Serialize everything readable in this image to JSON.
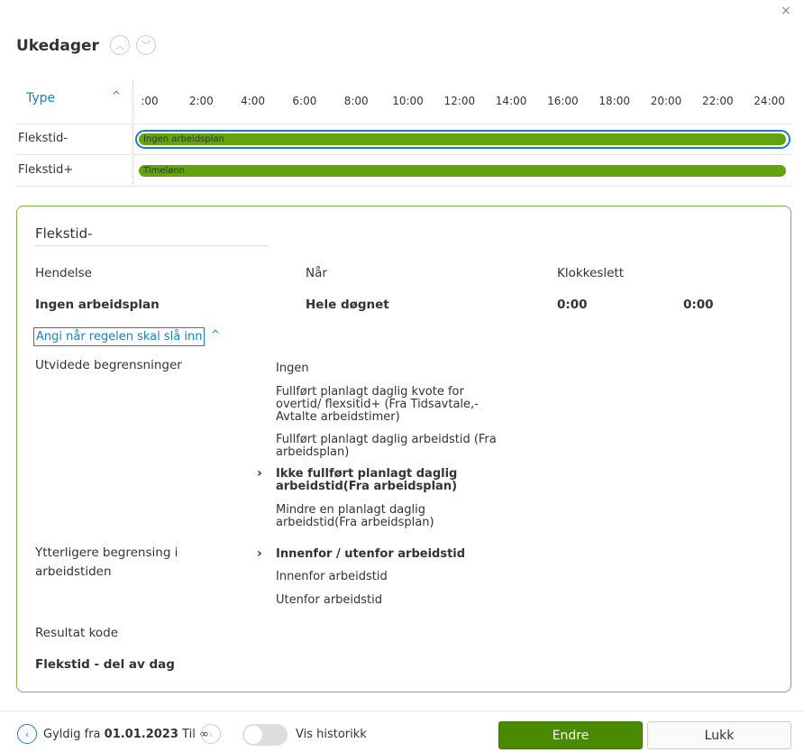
{
  "header": {
    "title": "Ukedager",
    "close": "×",
    "up": "︿",
    "down": "﹀"
  },
  "timeline": {
    "type_header": "Type",
    "sort_icon": "^",
    "hours": [
      ":00",
      "2:00",
      "4:00",
      "6:00",
      "8:00",
      "10:00",
      "12:00",
      "14:00",
      "16:00",
      "18:00",
      "20:00",
      "22:00",
      "24:00"
    ],
    "rows": [
      {
        "label": "Flekstid-",
        "bar": "Ingen arbeidsplan"
      },
      {
        "label": "Flekstid+",
        "bar": "Timelønn"
      }
    ]
  },
  "detail": {
    "name": "Flekstid-",
    "col_event": "Hendelse",
    "col_when": "Når",
    "col_time": "Klokkeslett",
    "event": "Ingen arbeidsplan",
    "when": "Hele døgnet",
    "time_from": "0:00",
    "time_to": "0:00",
    "rule_link": "Angi når regelen skal slå inn",
    "ext_label": "Utvidede begrensninger",
    "ext_options": [
      "Ingen",
      "Fullført planlagt daglig kvote for overtid/ flexsitid+ (Fra Tidsavtale,- Avtalte arbeidstimer)",
      "Fullført planlagt daglig arbeidstid (Fra arbeidsplan)",
      "Ikke fullført planlagt daglig arbeidstid(Fra arbeidsplan)",
      "Mindre en planlagt daglig arbeidstid(Fra arbeidsplan)"
    ],
    "further_label": "Ytterligere begrensing i arbeidstiden",
    "further_options": [
      "Innenfor / utenfor arbeidstid",
      "Innenfor arbeidstid",
      "Utenfor arbeidstid"
    ],
    "result_label": "Resultat kode",
    "result": "Flekstid - del av dag"
  },
  "footer": {
    "valid_from": "Gyldig fra",
    "date": "01.01.2023",
    "til": "Til ∞",
    "history": "Vis historikk",
    "edit": "Endre",
    "close": "Lukk"
  },
  "colors": {
    "accent": "#1a7fc1",
    "green": "#62a30f",
    "button": "#4a8a00"
  }
}
